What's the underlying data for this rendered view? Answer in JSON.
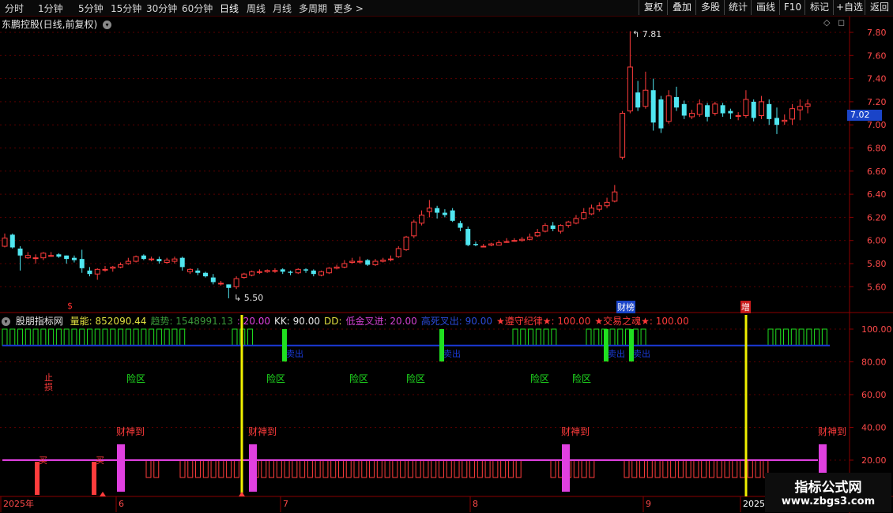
{
  "toolbar": {
    "left": [
      "分时",
      "1分钟",
      "5分钟",
      "15分钟",
      "30分钟",
      "60分钟",
      "日线",
      "周线",
      "月线",
      "多周期",
      "更多 >"
    ],
    "right": [
      "复权",
      "叠加",
      "多股",
      "统计",
      "画线",
      "F10",
      "标记",
      "+自选",
      "返回"
    ]
  },
  "stock": {
    "title": "东鹏控股(日线,前复权)",
    "current_price": "7.02",
    "high_label": "7.81",
    "low_label": "5.50"
  },
  "price_axis": [
    "7.80",
    "7.60",
    "7.40",
    "7.20",
    "7.00",
    "6.80",
    "6.60",
    "6.40",
    "6.20",
    "6.00",
    "5.80",
    "5.60"
  ],
  "indicator_axis": [
    "100.00",
    "80.00",
    "60.00",
    "40.00",
    "20.00"
  ],
  "indicator": {
    "name": "股朋指标网",
    "items": [
      {
        "label": "量能: 852090.44",
        "color": "#e0e040"
      },
      {
        "label": "趋势: 1548991.13",
        "color": "#3a9a3a"
      },
      {
        "label": ": 20.00",
        "color": "#e040e0"
      },
      {
        "label": "KK: 90.00",
        "color": "#e6e6e6"
      },
      {
        "label": "DD:",
        "color": "#e0e040"
      },
      {
        "label": "低金叉进: 20.00",
        "color": "#d040d0"
      },
      {
        "label": "高死叉出: 90.00",
        "color": "#2a4ad8"
      },
      {
        "label": "★遵守纪律★: 100.00",
        "color": "#ff3a3a"
      },
      {
        "label": "★交易之魂★: 100.00",
        "color": "#ff3a3a"
      }
    ]
  },
  "annotations": {
    "caibang": "财榜",
    "zeng": "增",
    "zhishang": "止\n损",
    "dollar": "$",
    "xianqu": "险区",
    "maichu": "卖出",
    "caishen": "财神到",
    "mai": "买"
  },
  "date_axis": [
    "2025年",
    "6",
    "7",
    "8",
    "9",
    "2025/"
  ],
  "colors": {
    "up": "#ff3c3c",
    "down": "#50e6f0",
    "yellow": "#f0f000",
    "magenta": "#e040e0",
    "blue": "#1a3ad8",
    "green": "#20e020"
  },
  "watermark": {
    "line1": "指标公式网",
    "line2": "www.zbgs3.com"
  },
  "chart_data": {
    "type": "candlestick",
    "candles": [
      [
        5.95,
        6.02,
        5.94,
        6.06
      ],
      [
        6.05,
        5.94,
        5.93,
        6.06
      ],
      [
        5.93,
        5.87,
        5.74,
        5.95
      ],
      [
        5.85,
        5.87,
        5.84,
        5.9
      ],
      [
        5.85,
        5.85,
        5.8,
        5.88
      ],
      [
        5.85,
        5.89,
        5.83,
        5.9
      ],
      [
        5.87,
        5.87,
        5.86,
        5.9
      ],
      [
        5.88,
        5.86,
        5.85,
        5.89
      ],
      [
        5.87,
        5.84,
        5.8,
        5.87
      ],
      [
        5.85,
        5.83,
        5.81,
        5.87
      ],
      [
        5.84,
        5.76,
        5.72,
        5.92
      ],
      [
        5.74,
        5.71,
        5.69,
        5.77
      ],
      [
        5.71,
        5.75,
        5.66,
        5.76
      ],
      [
        5.75,
        5.75,
        5.73,
        5.78
      ],
      [
        5.76,
        5.77,
        5.73,
        5.78
      ],
      [
        5.77,
        5.79,
        5.76,
        5.81
      ],
      [
        5.8,
        5.82,
        5.79,
        5.85
      ],
      [
        5.82,
        5.86,
        5.81,
        5.87
      ],
      [
        5.87,
        5.84,
        5.83,
        5.88
      ],
      [
        5.84,
        5.84,
        5.82,
        5.86
      ],
      [
        5.84,
        5.82,
        5.8,
        5.86
      ],
      [
        5.81,
        5.83,
        5.8,
        5.85
      ],
      [
        5.82,
        5.84,
        5.8,
        5.86
      ],
      [
        5.85,
        5.77,
        5.74,
        5.86
      ],
      [
        5.73,
        5.75,
        5.71,
        5.76
      ],
      [
        5.74,
        5.72,
        5.7,
        5.76
      ],
      [
        5.72,
        5.69,
        5.68,
        5.73
      ],
      [
        5.68,
        5.64,
        5.62,
        5.71
      ],
      [
        5.63,
        5.63,
        5.61,
        5.65
      ],
      [
        5.62,
        5.59,
        5.5,
        5.62
      ],
      [
        5.6,
        5.67,
        5.58,
        5.69
      ],
      [
        5.68,
        5.71,
        5.67,
        5.72
      ],
      [
        5.7,
        5.73,
        5.69,
        5.74
      ],
      [
        5.73,
        5.73,
        5.71,
        5.75
      ],
      [
        5.73,
        5.74,
        5.72,
        5.75
      ],
      [
        5.74,
        5.74,
        5.72,
        5.76
      ],
      [
        5.75,
        5.73,
        5.71,
        5.76
      ],
      [
        5.73,
        5.72,
        5.7,
        5.74
      ],
      [
        5.72,
        5.75,
        5.71,
        5.76
      ],
      [
        5.75,
        5.74,
        5.72,
        5.76
      ],
      [
        5.74,
        5.71,
        5.69,
        5.75
      ],
      [
        5.7,
        5.73,
        5.69,
        5.74
      ],
      [
        5.72,
        5.76,
        5.71,
        5.77
      ],
      [
        5.76,
        5.77,
        5.75,
        5.79
      ],
      [
        5.77,
        5.8,
        5.76,
        5.83
      ],
      [
        5.81,
        5.82,
        5.8,
        5.85
      ],
      [
        5.82,
        5.82,
        5.8,
        5.86
      ],
      [
        5.83,
        5.79,
        5.78,
        5.84
      ],
      [
        5.79,
        5.82,
        5.78,
        5.84
      ],
      [
        5.82,
        5.83,
        5.81,
        5.85
      ],
      [
        5.84,
        5.84,
        5.82,
        5.87
      ],
      [
        5.86,
        5.93,
        5.85,
        5.95
      ],
      [
        5.92,
        6.03,
        5.91,
        6.04
      ],
      [
        6.04,
        6.16,
        6.02,
        6.18
      ],
      [
        6.15,
        6.22,
        6.13,
        6.26
      ],
      [
        6.25,
        6.28,
        6.2,
        6.35
      ],
      [
        6.28,
        6.24,
        6.19,
        6.3
      ],
      [
        6.24,
        6.22,
        6.2,
        6.27
      ],
      [
        6.26,
        6.17,
        6.16,
        6.28
      ],
      [
        6.15,
        6.11,
        6.08,
        6.17
      ],
      [
        6.1,
        5.96,
        5.95,
        6.12
      ],
      [
        5.97,
        5.96,
        5.95,
        5.99
      ],
      [
        5.95,
        5.95,
        5.94,
        5.97
      ],
      [
        5.96,
        5.97,
        5.95,
        5.98
      ],
      [
        5.96,
        5.98,
        5.96,
        6.0
      ],
      [
        5.99,
        5.99,
        5.98,
        6.02
      ],
      [
        6.0,
        6.0,
        5.99,
        6.02
      ],
      [
        6.0,
        6.01,
        5.99,
        6.03
      ],
      [
        6.01,
        6.03,
        6.0,
        6.06
      ],
      [
        6.04,
        6.07,
        6.03,
        6.1
      ],
      [
        6.08,
        6.13,
        6.07,
        6.15
      ],
      [
        6.13,
        6.1,
        6.08,
        6.16
      ],
      [
        6.08,
        6.13,
        6.06,
        6.14
      ],
      [
        6.13,
        6.16,
        6.11,
        6.17
      ],
      [
        6.15,
        6.19,
        6.14,
        6.22
      ],
      [
        6.19,
        6.24,
        6.18,
        6.28
      ],
      [
        6.23,
        6.28,
        6.22,
        6.31
      ],
      [
        6.27,
        6.3,
        6.25,
        6.33
      ],
      [
        6.3,
        6.33,
        6.28,
        6.37
      ],
      [
        6.34,
        6.42,
        6.33,
        6.48
      ],
      [
        6.72,
        7.1,
        6.7,
        7.12
      ],
      [
        7.12,
        7.5,
        7.1,
        7.81
      ],
      [
        7.28,
        7.15,
        7.12,
        7.38
      ],
      [
        7.16,
        7.3,
        7.14,
        7.46
      ],
      [
        7.3,
        7.02,
        6.95,
        7.4
      ],
      [
        7.22,
        6.97,
        6.93,
        7.25
      ],
      [
        7.03,
        7.25,
        7.01,
        7.3
      ],
      [
        7.24,
        7.15,
        7.12,
        7.33
      ],
      [
        7.18,
        7.08,
        7.05,
        7.21
      ],
      [
        7.07,
        7.1,
        7.05,
        7.13
      ],
      [
        7.09,
        7.18,
        7.07,
        7.22
      ],
      [
        7.17,
        7.07,
        7.03,
        7.19
      ],
      [
        7.1,
        7.18,
        7.08,
        7.2
      ],
      [
        7.17,
        7.1,
        7.07,
        7.19
      ],
      [
        7.12,
        7.1,
        7.05,
        7.14
      ],
      [
        7.08,
        7.08,
        7.04,
        7.11
      ],
      [
        7.08,
        7.22,
        7.06,
        7.3
      ],
      [
        7.2,
        7.06,
        7.03,
        7.22
      ],
      [
        7.08,
        7.2,
        7.05,
        7.25
      ],
      [
        7.18,
        7.05,
        7.0,
        7.22
      ],
      [
        7.06,
        7.0,
        6.92,
        7.15
      ],
      [
        7.03,
        7.04,
        7.0,
        7.09
      ],
      [
        7.05,
        7.14,
        7.0,
        7.18
      ],
      [
        7.13,
        7.16,
        7.04,
        7.22
      ],
      [
        7.16,
        7.18,
        7.1,
        7.22
      ]
    ]
  }
}
